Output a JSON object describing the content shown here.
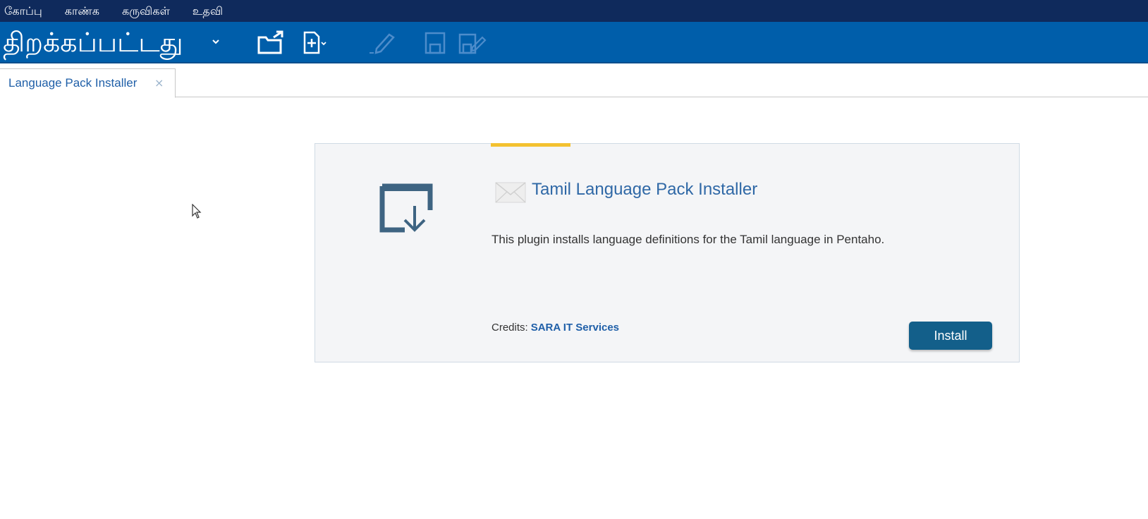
{
  "menubar": {
    "items": [
      {
        "label": "கோப்பு"
      },
      {
        "label": "காண்க"
      },
      {
        "label": "கருவிகள்"
      },
      {
        "label": "உதவி"
      }
    ]
  },
  "toolbar": {
    "perspective": "திறக்கப்பட்டது",
    "icons": [
      "open-folder-icon",
      "new-file-icon",
      "edit-icon",
      "save-icon",
      "save-as-icon"
    ]
  },
  "tabs": [
    {
      "label": "Language Pack Installer",
      "close": "×"
    }
  ],
  "plugin": {
    "title": "Tamil Language Pack Installer",
    "description": "This plugin installs language definitions for the Tamil language in Pentaho.",
    "credits_label": "Credits:",
    "credits_link": "SARA IT Services",
    "install_label": "Install"
  },
  "colors": {
    "menubar": "#0f2a5c",
    "toolbar": "#005eaa",
    "accent": "#f3c130",
    "install_button": "#135f8a",
    "link": "#1f5fa8"
  }
}
